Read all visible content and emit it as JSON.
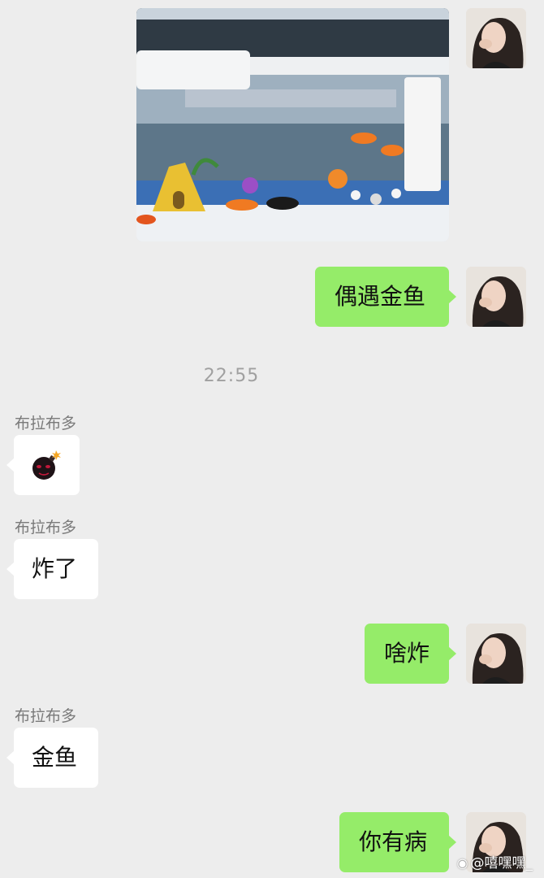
{
  "conversation": {
    "timestamp": "22:55",
    "messages": [
      {
        "from": "me",
        "type": "image",
        "description_icon": "aquarium-photo"
      },
      {
        "from": "me",
        "type": "text",
        "text": "偶遇金鱼"
      },
      {
        "from": "other",
        "sender": "布拉布多",
        "type": "emoji",
        "icon": "bomb-emoji"
      },
      {
        "from": "other",
        "sender": "布拉布多",
        "type": "text",
        "text": "炸了"
      },
      {
        "from": "me",
        "type": "text",
        "text": "啥炸"
      },
      {
        "from": "other",
        "sender": "布拉布多",
        "type": "text",
        "text": "金鱼"
      },
      {
        "from": "me",
        "type": "text",
        "text": "你有病"
      }
    ]
  },
  "watermark": {
    "text": "@嘻嘿嘿_"
  },
  "colors": {
    "background": "#ededed",
    "outgoing_bubble": "#95ec69",
    "incoming_bubble": "#ffffff",
    "sender_name": "#7a7a7a",
    "timestamp": "#a0a0a0"
  }
}
